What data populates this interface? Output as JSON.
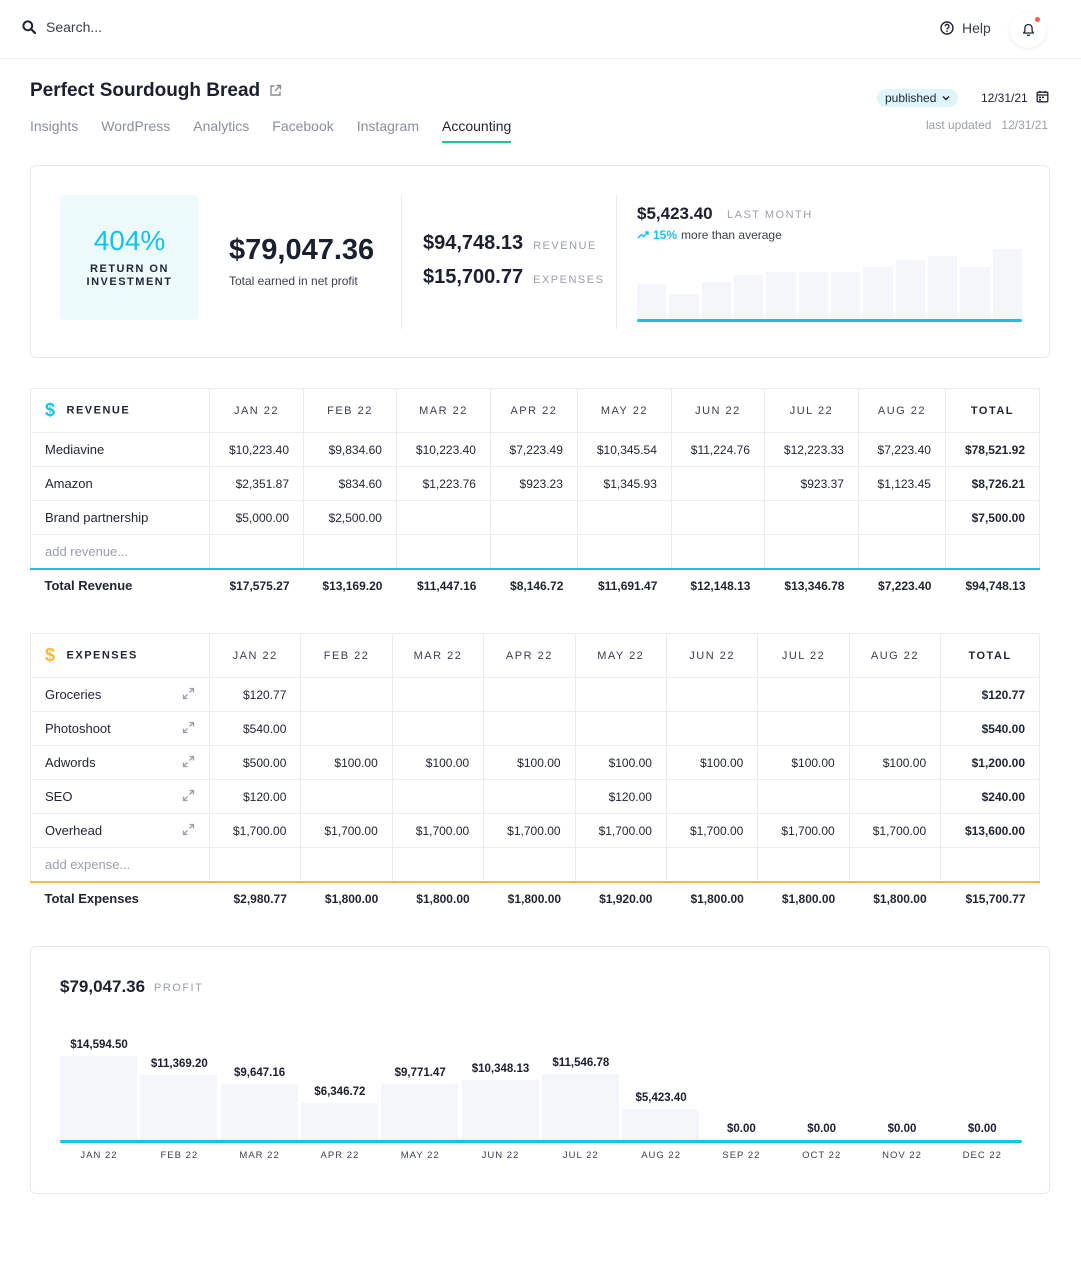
{
  "topbar": {
    "search_placeholder": "Search...",
    "help_label": "Help"
  },
  "header": {
    "title": "Perfect Sourdough Bread",
    "tabs": [
      "Insights",
      "WordPress",
      "Analytics",
      "Facebook",
      "Instagram",
      "Accounting"
    ],
    "active_tab": "Accounting",
    "status": "published",
    "date": "12/31/21",
    "last_updated_label": "last updated",
    "last_updated_date": "12/31/21"
  },
  "summary": {
    "roi_value": "404%",
    "roi_label_1": "RETURN ON",
    "roi_label_2": "INVESTMENT",
    "net_profit": "$79,047.36",
    "net_profit_label": "Total earned in net profit",
    "revenue_value": "$94,748.13",
    "revenue_label": "REVENUE",
    "expenses_value": "$15,700.77",
    "expenses_label": "EXPENSES",
    "last_month_value": "$5,423.40",
    "last_month_label": "LAST MONTH",
    "trend_pct": "15%",
    "trend_text": "more than average",
    "mini_chart_levels": [
      0.52,
      0.39,
      0.55,
      0.65,
      0.69,
      0.69,
      0.69,
      0.76,
      0.85,
      0.91,
      0.76,
      1.0
    ]
  },
  "revenue_table": {
    "title": "REVENUE",
    "months": [
      "JAN 22",
      "FEB 22",
      "MAR 22",
      "APR 22",
      "MAY 22",
      "JUN 22",
      "JUL 22",
      "AUG 22"
    ],
    "total_header": "TOTAL",
    "rows": [
      {
        "name": "Mediavine",
        "values": [
          "$10,223.40",
          "$9,834.60",
          "$10,223.40",
          "$7,223.49",
          "$10,345.54",
          "$11,224.76",
          "$12,223.33",
          "$7,223.40"
        ],
        "total": "$78,521.92"
      },
      {
        "name": "Amazon",
        "values": [
          "$2,351.87",
          "$834.60",
          "$1,223.76",
          "$923.23",
          "$1,345.93",
          "",
          "$923.37",
          "$1,123.45"
        ],
        "total": "$8,726.21"
      },
      {
        "name": "Brand partnership",
        "values": [
          "$5,000.00",
          "$2,500.00",
          "",
          "",
          "",
          "",
          "",
          ""
        ],
        "total": "$7,500.00"
      }
    ],
    "add_placeholder": "add revenue...",
    "total_row": {
      "name": "Total Revenue",
      "values": [
        "$17,575.27",
        "$13,169.20",
        "$11,447.16",
        "$8,146.72",
        "$11,691.47",
        "$12,148.13",
        "$13,346.78",
        "$7,223.40"
      ],
      "total": "$94,748.13"
    }
  },
  "expenses_table": {
    "title": "EXPENSES",
    "months": [
      "JAN 22",
      "FEB 22",
      "MAR 22",
      "APR 22",
      "MAY 22",
      "JUN 22",
      "JUL 22",
      "AUG 22"
    ],
    "total_header": "TOTAL",
    "rows": [
      {
        "name": "Groceries",
        "values": [
          "$120.77",
          "",
          "",
          "",
          "",
          "",
          "",
          ""
        ],
        "total": "$120.77"
      },
      {
        "name": "Photoshoot",
        "values": [
          "$540.00",
          "",
          "",
          "",
          "",
          "",
          "",
          ""
        ],
        "total": "$540.00"
      },
      {
        "name": "Adwords",
        "values": [
          "$500.00",
          "$100.00",
          "$100.00",
          "$100.00",
          "$100.00",
          "$100.00",
          "$100.00",
          "$100.00"
        ],
        "total": "$1,200.00"
      },
      {
        "name": "SEO",
        "values": [
          "$120.00",
          "",
          "",
          "",
          "$120.00",
          "",
          "",
          ""
        ],
        "total": "$240.00"
      },
      {
        "name": "Overhead",
        "values": [
          "$1,700.00",
          "$1,700.00",
          "$1,700.00",
          "$1,700.00",
          "$1,700.00",
          "$1,700.00",
          "$1,700.00",
          "$1,700.00"
        ],
        "total": "$13,600.00"
      }
    ],
    "add_placeholder": "add expense...",
    "total_row": {
      "name": "Total Expenses",
      "values": [
        "$2,980.77",
        "$1,800.00",
        "$1,800.00",
        "$1,800.00",
        "$1,920.00",
        "$1,800.00",
        "$1,800.00",
        "$1,800.00"
      ],
      "total": "$15,700.77"
    }
  },
  "profit": {
    "value": "$79,047.36",
    "label": "PROFIT"
  },
  "chart_data": {
    "type": "bar",
    "categories": [
      "JAN 22",
      "FEB 22",
      "MAR 22",
      "APR 22",
      "MAY 22",
      "JUN 22",
      "JUL 22",
      "AUG 22",
      "SEP 22",
      "OCT 22",
      "NOV 22",
      "DEC 22"
    ],
    "values": [
      14594.5,
      11369.2,
      9647.16,
      6346.72,
      9771.47,
      10348.13,
      11546.78,
      5423.4,
      0,
      0,
      0,
      0
    ],
    "data_labels": [
      "$14,594.50",
      "$11,369.20",
      "$9,647.16",
      "$6,346.72",
      "$9,771.47",
      "$10,348.13",
      "$11,546.78",
      "$5,423.40",
      "$0.00",
      "$0.00",
      "$0.00",
      "$0.00"
    ],
    "title": "",
    "xlabel": "",
    "ylabel": "",
    "grid": false
  },
  "colors": {
    "accent_cyan": "#14c4e6",
    "accent_green": "#1fc3a0",
    "accent_orange": "#f7b93a"
  }
}
